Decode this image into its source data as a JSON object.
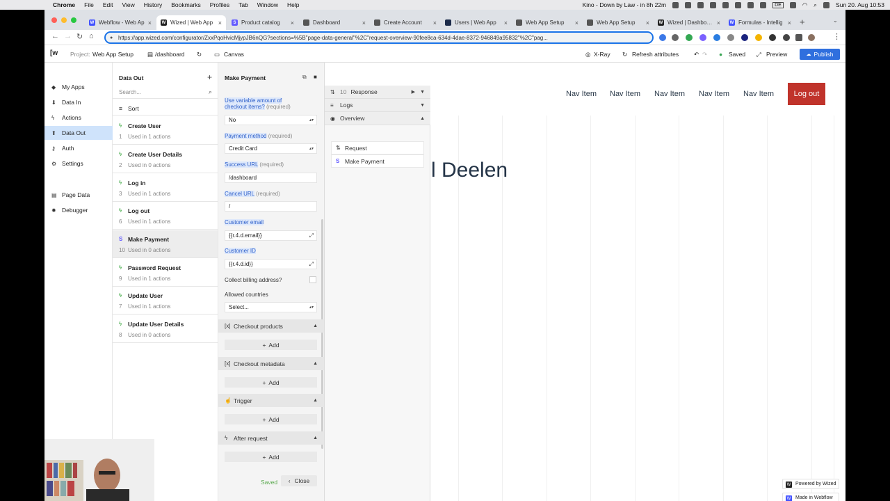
{
  "menubar": {
    "items": [
      "Chrome",
      "File",
      "Edit",
      "View",
      "History",
      "Bookmarks",
      "Profiles",
      "Tab",
      "Window",
      "Help"
    ],
    "now_playing": "Kino - Down by Law - in 8h 22m",
    "lang": "DE",
    "clock": "Sun 20. Aug  10:53"
  },
  "tabs": [
    {
      "label": "Webflow - Web Ap",
      "fav": "W",
      "color": "#4353ff"
    },
    {
      "label": "Wized | Web App",
      "fav": "W",
      "color": "#222222"
    },
    {
      "label": "Product catalog",
      "fav": "S",
      "color": "#635bff"
    },
    {
      "label": "Dashboard",
      "fav": "",
      "color": "#555555"
    },
    {
      "label": "Create Account",
      "fav": "",
      "color": "#555555"
    },
    {
      "label": "Users | Web App",
      "fav": "",
      "color": "#1c2b4a"
    },
    {
      "label": "Web App Setup",
      "fav": "",
      "color": "#555555"
    },
    {
      "label": "Web App Setup",
      "fav": "",
      "color": "#555555"
    },
    {
      "label": "Wized | Dashboard",
      "fav": "W",
      "color": "#222222"
    },
    {
      "label": "Formulas - Intellig",
      "fav": "W",
      "color": "#4353ff"
    }
  ],
  "address": {
    "url": "https://app.wized.com/configurator/ZxxPqoHvicMjypJB6nQG?sections=%5B\"page-data-general\"%2C\"request-overview-90fee8ca-634d-4dae-8372-946849a95832\"%2C\"pag..."
  },
  "toolbar": {
    "logo": "[w",
    "project_label": "Project:",
    "project_name": "Web App Setup",
    "page": "/dashboard",
    "canvas": "Canvas",
    "xray": "X-Ray",
    "refresh": "Refresh attributes",
    "saved": "Saved",
    "preview": "Preview",
    "publish": "Publish"
  },
  "sidebar": {
    "items": [
      {
        "label": "My Apps",
        "icon": "layers-icon"
      },
      {
        "label": "Data In",
        "icon": "download-icon"
      },
      {
        "label": "Actions",
        "icon": "bolt-icon"
      },
      {
        "label": "Data Out",
        "icon": "upload-icon"
      },
      {
        "label": "Auth",
        "icon": "key-icon"
      },
      {
        "label": "Settings",
        "icon": "gear-icon"
      },
      {
        "label": "Page Data",
        "icon": "page-icon"
      },
      {
        "label": "Debugger",
        "icon": "bug-icon"
      }
    ]
  },
  "data_out": {
    "title": "Data Out",
    "search_placeholder": "Search...",
    "sort": "Sort",
    "requests": [
      {
        "name": "Create User",
        "num": "1",
        "used": "Used in 1 actions",
        "type": "bolt"
      },
      {
        "name": "Create User Details",
        "num": "2",
        "used": "Used in 0 actions",
        "type": "bolt"
      },
      {
        "name": "Log in",
        "num": "3",
        "used": "Used in 1 actions",
        "type": "bolt"
      },
      {
        "name": "Log out",
        "num": "6",
        "used": "Used in 1 actions",
        "type": "bolt"
      },
      {
        "name": "Make Payment",
        "num": "10",
        "used": "Used in 0 actions",
        "type": "stripe"
      },
      {
        "name": "Password Request",
        "num": "9",
        "used": "Used in 1 actions",
        "type": "bolt"
      },
      {
        "name": "Update User",
        "num": "7",
        "used": "Used in 1 actions",
        "type": "bolt"
      },
      {
        "name": "Update User Details",
        "num": "8",
        "used": "Used in 0 actions",
        "type": "bolt"
      }
    ]
  },
  "config": {
    "title": "Make Payment",
    "variable_label": "Use variable amount of checkout items?",
    "required": "(required)",
    "variable_value": "No",
    "payment_label": "Payment method",
    "payment_value": "Credit Card",
    "success_label": "Success URL",
    "success_value": "/dashboard",
    "cancel_label": "Cancel URL",
    "cancel_value": "/",
    "email_label": "Customer email",
    "email_value": "{{r.4.d.email}}",
    "customer_label": "Customer ID",
    "customer_value": "{{r.4.d.id}}",
    "billing_label": "Collect billing address?",
    "countries_label": "Allowed countries",
    "countries_value": "Select...",
    "sections": [
      "Checkout products",
      "Checkout metadata",
      "Trigger",
      "After request"
    ],
    "add": "Add",
    "saved": "Saved",
    "close": "Close"
  },
  "response": {
    "num": "10",
    "response": "Response",
    "logs": "Logs",
    "overview": "Overview",
    "items": [
      "Request",
      "Make Payment"
    ]
  },
  "canvas": {
    "nav": [
      "Nav Item",
      "Nav Item",
      "Nav Item",
      "Nav Item",
      "Nav Item"
    ],
    "logout": "Log out",
    "heading": "l Deelen",
    "badge1": "Powered by Wized",
    "badge2": "Made in Webflow"
  },
  "colors": {
    "accent": "#2f6fde",
    "logout": "#c0332b",
    "saved": "#5aa94e",
    "highlight": "#dde8fb"
  }
}
